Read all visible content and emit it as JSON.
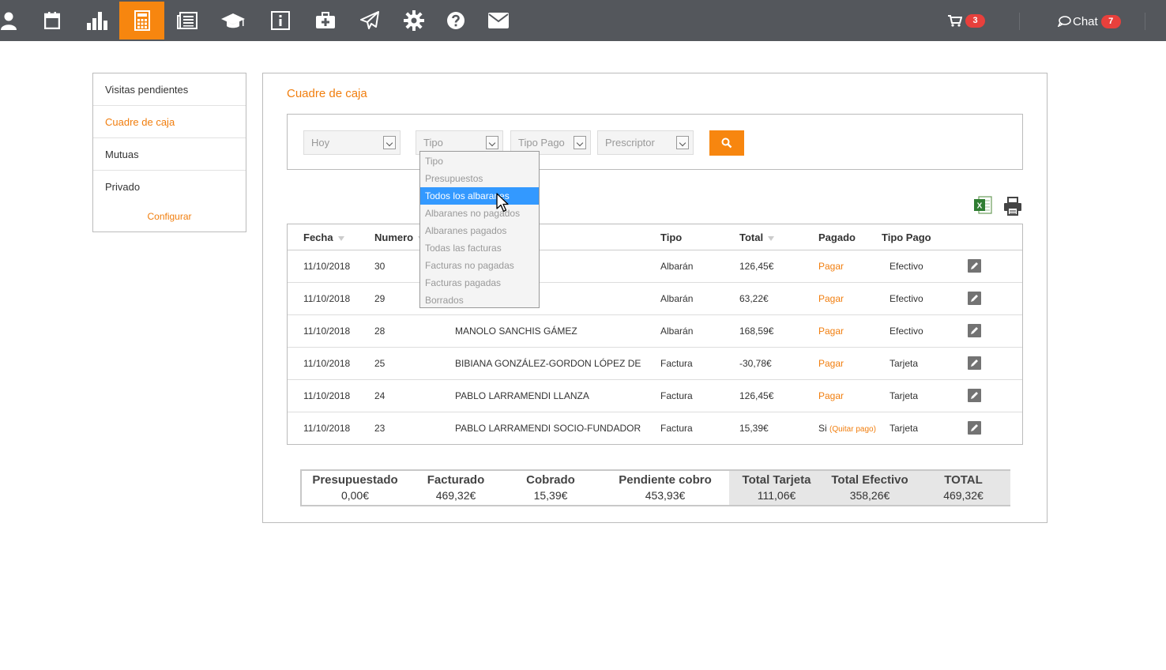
{
  "colors": {
    "accent": "#f7860f",
    "topbar": "#54575c",
    "badge": "#e8403c",
    "highlight": "#3399ff"
  },
  "topnav": {
    "icons": [
      "user-icon",
      "calendar-icon",
      "bar-chart-icon",
      "calculator-icon",
      "newspaper-icon",
      "graduation-cap-icon",
      "info-icon",
      "medkit-icon",
      "paper-plane-icon",
      "gear-icon",
      "question-icon",
      "envelope-icon"
    ],
    "active": "calculator-icon",
    "cart_count": "3",
    "chat_label": "Chat",
    "chat_count": "7"
  },
  "sidebar": {
    "items": [
      {
        "label": "Visitas pendientes",
        "active": false
      },
      {
        "label": "Cuadre de caja",
        "active": true
      },
      {
        "label": "Mutuas",
        "active": false
      },
      {
        "label": "Privado",
        "active": false
      }
    ],
    "config_label": "Configurar"
  },
  "main": {
    "title": "Cuadre de caja",
    "filters": {
      "periodo": "Hoy",
      "tipo": "Tipo",
      "tipo_pago": "Tipo Pago",
      "prescriptor": "Prescriptor"
    },
    "dropdown_options": [
      "Tipo",
      "Presupuestos",
      "Todos los albaranes",
      "Albaranes no pagados",
      "Albaranes pagados",
      "Todas las facturas",
      "Facturas no pagadas",
      "Facturas pagadas",
      "Borrados"
    ],
    "dropdown_highlighted": "Todos los albaranes",
    "table": {
      "headers": {
        "fecha": "Fecha",
        "numero": "Numero",
        "tipo": "Tipo",
        "total": "Total",
        "pagado": "Pagado",
        "tipo_pago": "Tipo Pago"
      },
      "rows": [
        {
          "fecha": "11/10/2018",
          "numero": "30",
          "paciente": "",
          "tipo": "Albarán",
          "total": "126,45€",
          "pagado": "Pagar",
          "quitar": "",
          "tipo_pago": "Efectivo"
        },
        {
          "fecha": "11/10/2018",
          "numero": "29",
          "paciente": "",
          "tipo": "Albarán",
          "total": "63,22€",
          "pagado": "Pagar",
          "quitar": "",
          "tipo_pago": "Efectivo"
        },
        {
          "fecha": "11/10/2018",
          "numero": "28",
          "paciente": "MANOLO SANCHIS GÁMEZ",
          "tipo": "Albarán",
          "total": "168,59€",
          "pagado": "Pagar",
          "quitar": "",
          "tipo_pago": "Efectivo"
        },
        {
          "fecha": "11/10/2018",
          "numero": "25",
          "paciente": "BIBIANA GONZÁLEZ-GORDON LÓPEZ DE",
          "tipo": "Factura",
          "total": "-30,78€",
          "pagado": "Pagar",
          "quitar": "",
          "tipo_pago": "Tarjeta"
        },
        {
          "fecha": "11/10/2018",
          "numero": "24",
          "paciente": "PABLO LARRAMENDI LLANZA",
          "tipo": "Factura",
          "total": "126,45€",
          "pagado": "Pagar",
          "quitar": "",
          "tipo_pago": "Tarjeta"
        },
        {
          "fecha": "11/10/2018",
          "numero": "23",
          "paciente": "PABLO LARRAMENDI SOCIO-FUNDADOR",
          "tipo": "Factura",
          "total": "15,39€",
          "pagado": "Si",
          "quitar": "(Quitar pago)",
          "tipo_pago": "Tarjeta"
        }
      ]
    },
    "totals": [
      {
        "label": "Presupuestado",
        "value": "0,00€"
      },
      {
        "label": "Facturado",
        "value": "469,32€"
      },
      {
        "label": "Cobrado",
        "value": "15,39€"
      },
      {
        "label": "Pendiente cobro",
        "value": "453,93€"
      },
      {
        "label": "Total Tarjeta",
        "value": "111,06€"
      },
      {
        "label": "Total Efectivo",
        "value": "358,26€"
      },
      {
        "label": "TOTAL",
        "value": "469,32€"
      }
    ]
  }
}
